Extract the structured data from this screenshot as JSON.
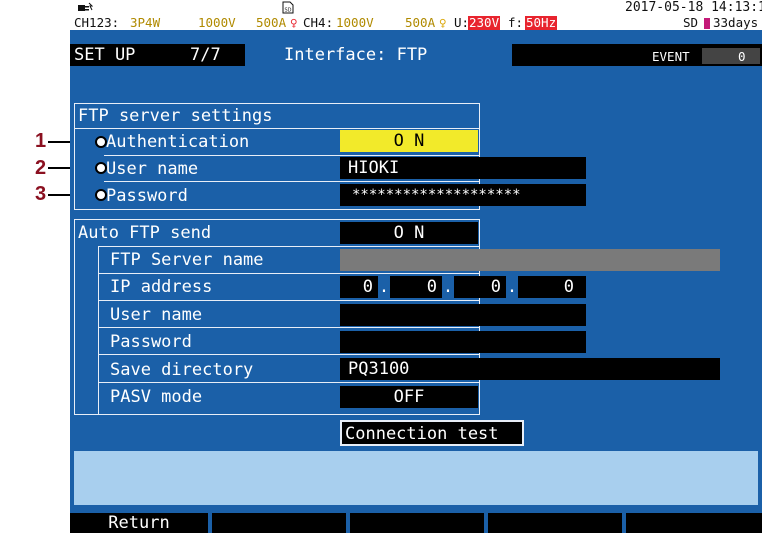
{
  "callouts": [
    "1",
    "2",
    "3"
  ],
  "status": {
    "datetime": "2017-05-18 14:13:18",
    "channels_a": "CH123:",
    "wiring": "3P4W",
    "voltage1": "1000V",
    "current1": "500A",
    "channels_b": "CH4:",
    "voltage2": "1000V",
    "current2": "500A",
    "u_label": "U:",
    "u_value": "230V",
    "f_label": "f:",
    "f_value": "50Hz",
    "sd_label": "SD",
    "sd_days": "33days",
    "event_label": "EVENT",
    "event_count": "0"
  },
  "header": {
    "mode": "SET UP",
    "page": "7/7",
    "title": "Interface: FTP"
  },
  "ftp_server": {
    "section_title": "FTP server settings",
    "authentication_label": "Authentication",
    "authentication_value": "O N",
    "user_name_label": "User name",
    "user_name_value": "HIOKI",
    "password_label": "Password",
    "password_value": "********************"
  },
  "auto_send": {
    "label": "Auto FTP send",
    "value": "O N",
    "server_name_label": "FTP Server name",
    "server_name_value": "",
    "ip_label": "IP address",
    "ip": [
      "0",
      "0",
      "0",
      "0"
    ],
    "user_name_label": "User name",
    "user_name_value": "",
    "password_label": "Password",
    "password_value": "",
    "save_dir_label": "Save directory",
    "save_dir_value": "PQ3100",
    "pasv_label": "PASV mode",
    "pasv_value": "OFF",
    "connection_test": "Connection test"
  },
  "footer": {
    "keys": [
      "Return",
      "",
      "",
      "",
      ""
    ]
  },
  "colors": {
    "screen_bg": "#1b60a8",
    "highlight_yellow": "#f2ea2a",
    "alarm_red": "#e8242e",
    "voltage_yellow": "#f2c20a",
    "info_panel": "#a8cfee",
    "sd_magenta": "#c41a78"
  }
}
